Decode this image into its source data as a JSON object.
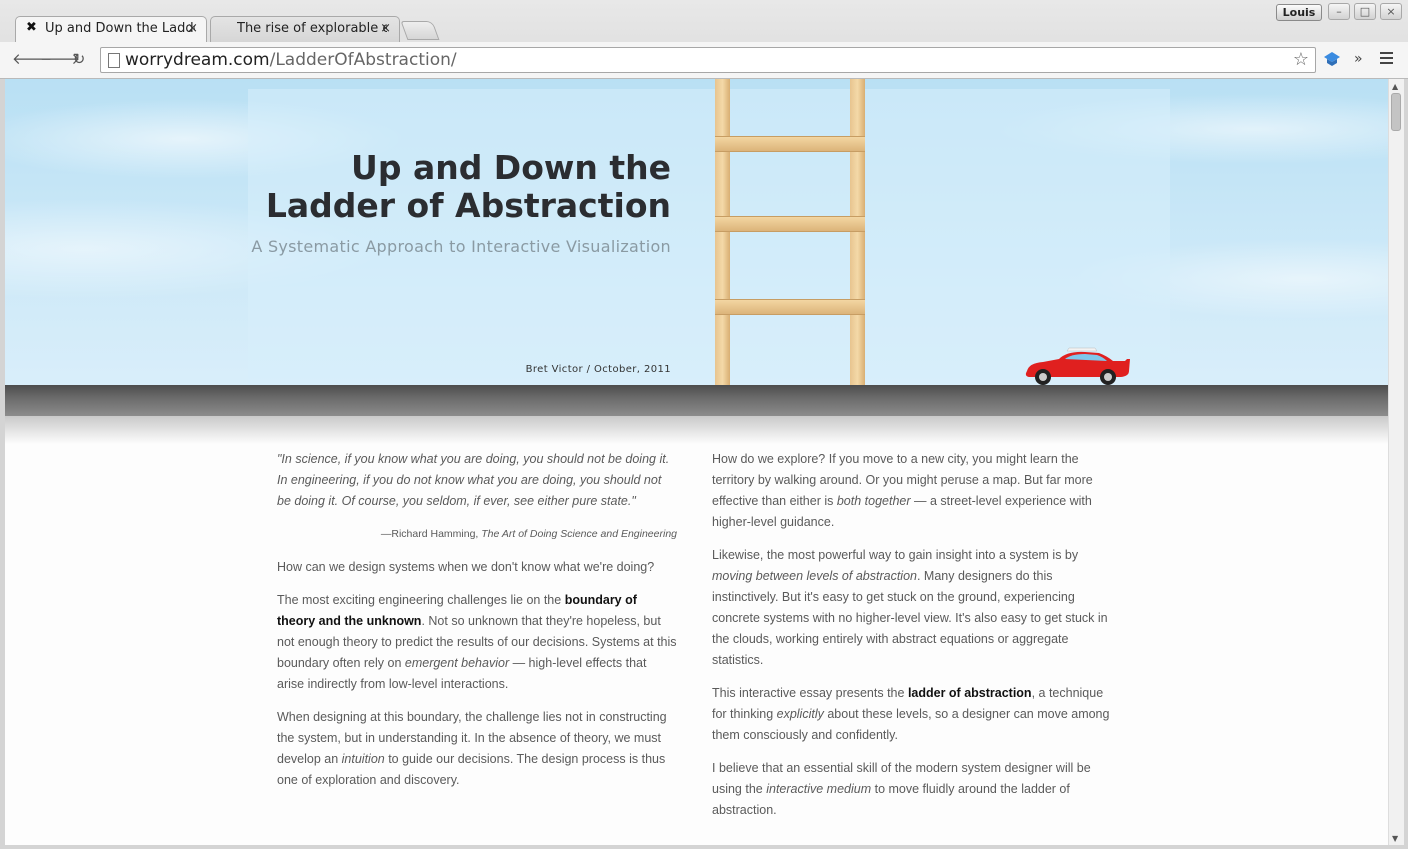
{
  "browser": {
    "tabs": [
      {
        "title": "Up and Down the Ladder of Abstraction",
        "active": true,
        "favicon": "ladder-favicon"
      },
      {
        "title": "The rise of explorable explanations",
        "active": false
      }
    ],
    "user": "Louis",
    "url_host": "worrydream.com",
    "url_path": "/LadderOfAbstraction/",
    "glyphs": {
      "back": "🡐",
      "forward": "🡒",
      "reload": "↻",
      "star": "☆",
      "more": "»",
      "close": "×",
      "minimize": "–",
      "maximize": "□",
      "window_close": "×",
      "favicon": "✖"
    }
  },
  "hero": {
    "title_line1": "Up and Down the",
    "title_line2": "Ladder of Abstraction",
    "subtitle": "A Systematic Approach to Interactive Visualization",
    "byline": "Bret Victor / October, 2011"
  },
  "quote": {
    "text": "\"In science, if you know what you are doing, you should not be doing it. In engineering, if you do not know what you are doing, you should not be doing it. Of course, you seldom, if ever, see either pure state.\"",
    "author": "—Richard Hamming, ",
    "source": "The Art of Doing Science and Engineering"
  },
  "left_column": {
    "p1": "How can we design systems when we don't know what we're doing?",
    "p2_a": "The most exciting engineering challenges lie on the ",
    "p2_b": "boundary of theory and the unknown",
    "p2_c": ". Not so unknown that they're hopeless, but not enough theory to predict the results of our decisions. Systems at this boundary often rely on ",
    "p2_d": "emergent behavior",
    "p2_e": " — high-level effects that arise indirectly from low-level interactions.",
    "p3_a": "When designing at this boundary, the challenge lies not in constructing the system, but in understanding it. In the absence of theory, we must develop an ",
    "p3_b": "intuition",
    "p3_c": " to guide our decisions. The design process is thus one of exploration and discovery."
  },
  "right_column": {
    "p1_a": "How do we explore? If you move to a new city, you might learn the territory by walking around. Or you might peruse a map. But far more effective than either is ",
    "p1_b": "both together",
    "p1_c": " — a street-level experience with higher-level guidance.",
    "p2_a": "Likewise, the most powerful way to gain insight into a system is by ",
    "p2_b": "moving between levels of abstraction",
    "p2_c": ". Many designers do this instinctively. But it's easy to get stuck on the ground, experiencing concrete systems with no higher-level view. It's also easy to get stuck in the clouds, working entirely with abstract equations or aggregate statistics.",
    "p3_a": "This interactive essay presents the ",
    "p3_b": "ladder of abstraction",
    "p3_c": ", a technique for thinking ",
    "p3_d": "explicitly",
    "p3_e": " about these levels, so a designer can move among them consciously and confidently.",
    "p4_a": "I believe that an essential skill of the modern system designer will be using the ",
    "p4_b": "interactive medium",
    "p4_c": " to move fluidly around the ladder of abstraction."
  },
  "colors": {
    "sky": "#b9e0f4",
    "road": "#5e5e5e",
    "car": "#e0201f",
    "ladder_wood": "#ecca95"
  }
}
